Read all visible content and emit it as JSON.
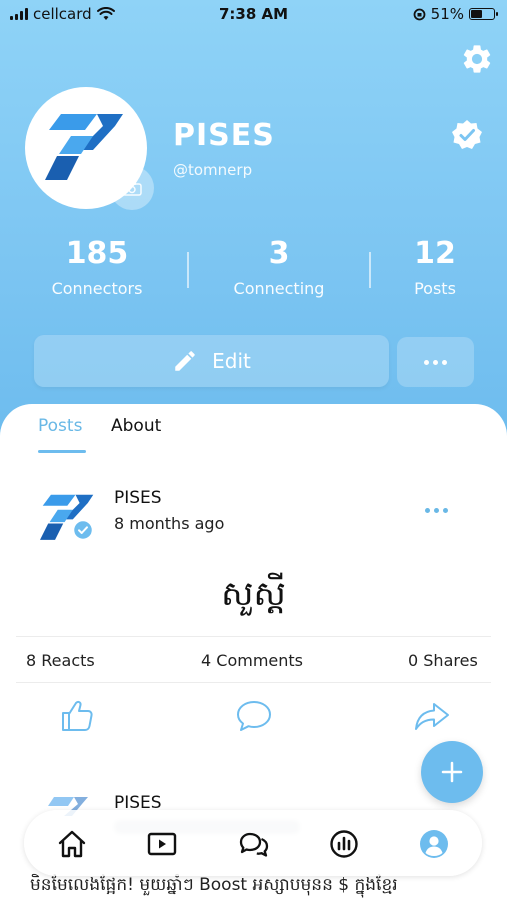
{
  "status_bar": {
    "carrier": "cellcard",
    "time": "7:38 AM",
    "battery": "51%",
    "battery_level": 0.51
  },
  "header": {
    "settings_icon": "gear-icon"
  },
  "profile": {
    "name": "PISES",
    "handle": "@tomnerp",
    "verified_icon": "verified-badge-icon",
    "avatar_icon": "pises-logo",
    "camera_icon": "camera-icon"
  },
  "stats": [
    {
      "value": "185",
      "label": "Connectors"
    },
    {
      "value": "3",
      "label": "Connecting"
    },
    {
      "value": "12",
      "label": "Posts"
    }
  ],
  "actions": {
    "edit_label": "Edit",
    "edit_icon": "pencil-icon",
    "more_icon": "more-icon"
  },
  "tabs": [
    {
      "label": "Posts",
      "active": true
    },
    {
      "label": "About",
      "active": false
    }
  ],
  "posts": [
    {
      "author": "PISES",
      "time": "8 months ago",
      "text": "សួស្តី",
      "reacts": "8 Reacts",
      "comments": "4 Comments",
      "shares": "0 Shares"
    },
    {
      "author": "PISES",
      "text": "មិនមែលេងផ្អែក! មួយឆ្នាំៗ Boost អស្សាបមុនន $ ក្នុងខ្មែរ"
    }
  ],
  "fab_icon": "plus-icon",
  "bottom_nav": [
    "home-icon",
    "video-icon",
    "chat-icon",
    "stats-icon",
    "profile-icon"
  ],
  "colors": {
    "accent": "#6dbcee",
    "header_gradient_top": "#8fd3f7",
    "header_gradient_bottom": "#6dbcee"
  }
}
